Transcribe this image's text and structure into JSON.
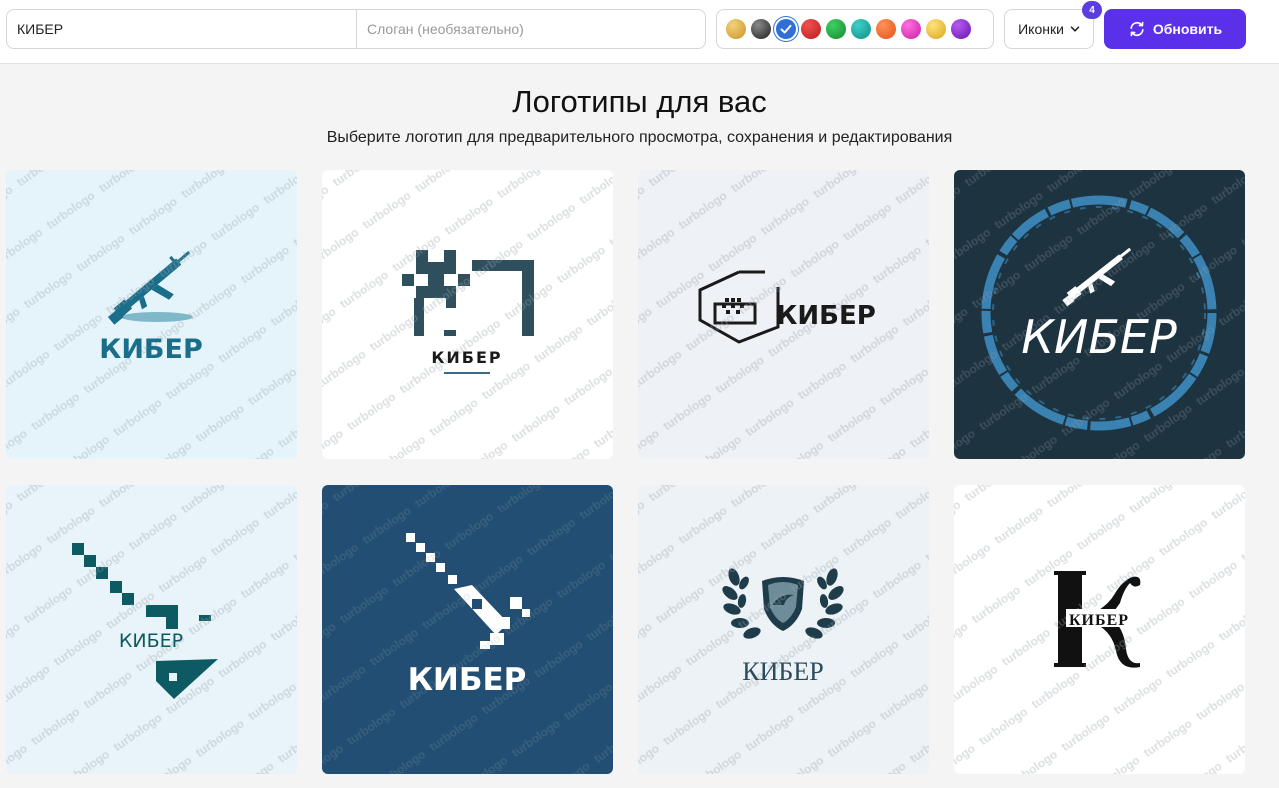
{
  "toolbar": {
    "name_value": "КИБЕР",
    "slogan_placeholder": "Слоган (необязательно)",
    "swatches": [
      {
        "name": "gold",
        "color": "#d9a93a"
      },
      {
        "name": "black",
        "color": "#333333"
      },
      {
        "name": "blue",
        "color": "#2f6fd6",
        "selected": true
      },
      {
        "name": "red",
        "color": "#d42a2a"
      },
      {
        "name": "green",
        "color": "#1aa63b"
      },
      {
        "name": "teal",
        "color": "#17a9a2"
      },
      {
        "name": "orange",
        "color": "#f06a2a"
      },
      {
        "name": "pink",
        "color": "#e23cc0"
      },
      {
        "name": "yellow",
        "color": "#e8c23a"
      },
      {
        "name": "purple",
        "color": "#8a22c9"
      }
    ],
    "icons_label": "Иконки",
    "icons_badge": "4",
    "refresh_label": "Обновить"
  },
  "heading": {
    "title": "Логотипы для вас",
    "subtitle": "Выберите логотип для предварительного просмотра, сохранения и редактирования"
  },
  "watermark": "turbologo",
  "logos": [
    {
      "text": "КИБЕР",
      "icon": "rifle-icon",
      "bg": "#e5f4fb",
      "fg": "#1b6e8a"
    },
    {
      "text": "КИБЕР",
      "icon": "pixel-invader-icon",
      "bg": "#ffffff",
      "fg": "#2f4f5c"
    },
    {
      "text": "КИБЕР",
      "icon": "pixel-hexagon-icon",
      "bg": "#eef1f6",
      "fg": "#1a1a1a"
    },
    {
      "text": "КИБЕР",
      "icon": "rifle-circle-icon",
      "bg": "#1d3340",
      "fg": "#ffffff"
    },
    {
      "text": "КИБЕР",
      "icon": "pixel-arrow-icon",
      "bg": "#e8f4f9",
      "fg": "#0e5a62"
    },
    {
      "text": "КИБЕР",
      "icon": "pixel-syringe-icon",
      "bg": "#214e72",
      "fg": "#ffffff"
    },
    {
      "text": "КИБЕР",
      "icon": "laurel-shield-icon",
      "bg": "#ecf2f6",
      "fg": "#2b4a5a"
    },
    {
      "text": "КИБЕР",
      "icon": "letter-k-icon",
      "bg": "#ffffff",
      "fg": "#111111"
    }
  ]
}
